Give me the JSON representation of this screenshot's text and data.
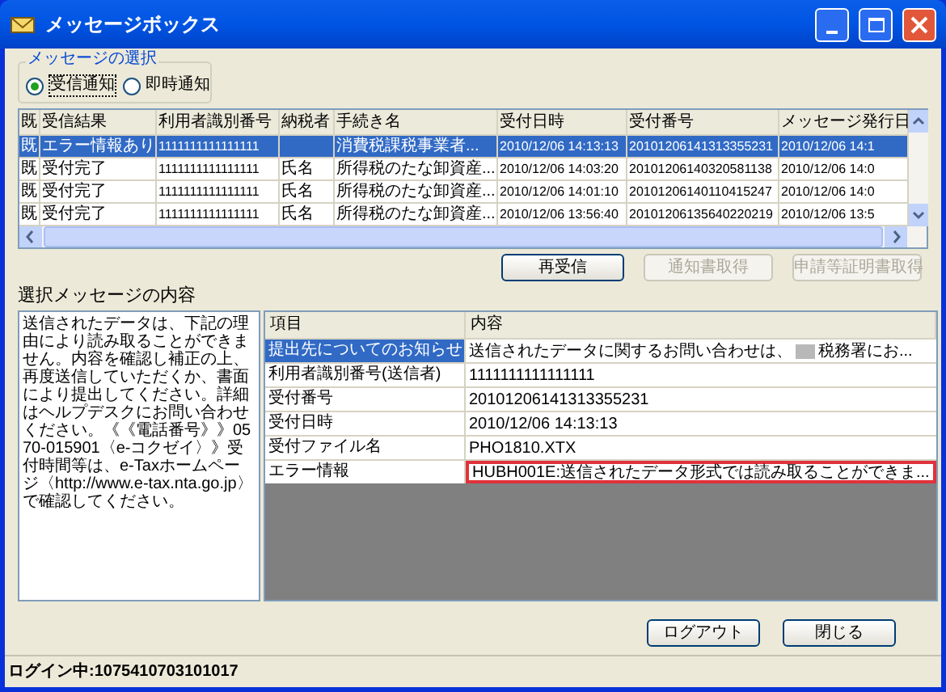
{
  "window": {
    "title": "メッセージボックス"
  },
  "message_selection": {
    "label": "メッセージの選択",
    "options": [
      {
        "label": "受信通知",
        "selected": true
      },
      {
        "label": "即時通知",
        "selected": false
      }
    ]
  },
  "message_table": {
    "columns": [
      "既",
      "受信結果",
      "利用者識別番号",
      "納税者",
      "手続き名",
      "受付日時",
      "受付番号",
      "メッセージ発行日"
    ],
    "rows": [
      {
        "selected": true,
        "cells": [
          "既",
          "エラー情報あり",
          "1111111111111111",
          "",
          "消費税課税事業者...",
          "2010/12/06 14:13:13",
          "20101206141313355231",
          "2010/12/06 14:1"
        ]
      },
      {
        "selected": false,
        "cells": [
          "既",
          "受付完了",
          "1111111111111111",
          "氏名",
          "所得税のたな卸資産...",
          "2010/12/06 14:03:20",
          "20101206140320581138",
          "2010/12/06 14:0"
        ]
      },
      {
        "selected": false,
        "cells": [
          "既",
          "受付完了",
          "1111111111111111",
          "氏名",
          "所得税のたな卸資産...",
          "2010/12/06 14:01:10",
          "20101206140110415247",
          "2010/12/06 14:0"
        ]
      },
      {
        "selected": false,
        "cells": [
          "既",
          "受付完了",
          "1111111111111111",
          "氏名",
          "所得税のたな卸資産...",
          "2010/12/06 13:56:40",
          "20101206135640220219",
          "2010/12/06 13:5"
        ]
      }
    ]
  },
  "table_buttons": [
    {
      "label": "再受信",
      "disabled": false
    },
    {
      "label": "通知書取得",
      "disabled": true
    },
    {
      "label": "申請等証明書取得",
      "disabled": true
    }
  ],
  "content_label": "選択メッセージの内容",
  "message_text": "送信されたデータは、下記の理由により読み取ることができません。内容を確認し補正の上、再度送信していただくか、書面により提出してください。詳細はヘルプデスクにお問い合わせください。《《電話番号》》0570-015901〈e-コクゼイ〉》受付時間等は、e-Taxホームページ〈http://www.e-tax.nta.go.jp〉で確認してください。",
  "detail_grid": {
    "columns": [
      "項目",
      "内容"
    ],
    "rows": [
      {
        "item": "提出先についてのお知らせ",
        "value": "送信されたデータに関するお問い合わせは、",
        "redacted": true,
        "value_after": "税務署にお...",
        "selected": true,
        "flagged": false
      },
      {
        "item": "利用者識別番号(送信者)",
        "value": "1111111111111111",
        "selected": false,
        "flagged": false
      },
      {
        "item": "受付番号",
        "value": "20101206141313355231",
        "selected": false,
        "flagged": false
      },
      {
        "item": "受付日時",
        "value": "2010/12/06 14:13:13",
        "selected": false,
        "flagged": false
      },
      {
        "item": "受付ファイル名",
        "value": "PHO1810.XTX",
        "selected": false,
        "flagged": false
      },
      {
        "item": "エラー情報",
        "value": "HUBH001E:送信されたデータ形式では読み取ることができま...",
        "selected": false,
        "flagged": true
      }
    ]
  },
  "bottom_buttons": [
    {
      "label": "ログアウト"
    },
    {
      "label": "閉じる"
    }
  ],
  "status_bar": {
    "text": "ログイン中:1075410703101017"
  }
}
